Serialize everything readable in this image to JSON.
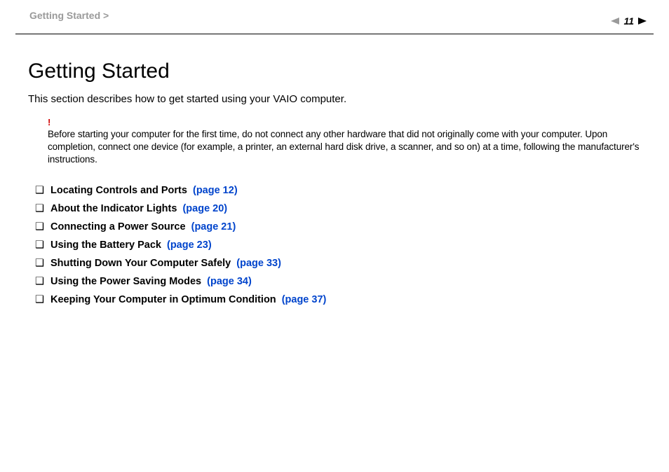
{
  "breadcrumb": "Getting Started >",
  "page_number": "11",
  "title": "Getting Started",
  "intro": "This section describes how to get started using your VAIO computer.",
  "warning_mark": "!",
  "warning_text": "Before starting your computer for the first time, do not connect any other hardware that did not originally come with your computer. Upon completion, connect one device (for example, a printer, an external hard disk drive, a scanner, and so on) at a time, following the manufacturer's instructions.",
  "bullet": "❑",
  "toc": [
    {
      "label": "Locating Controls and Ports",
      "page": "(page 12)"
    },
    {
      "label": "About the Indicator Lights",
      "page": "(page 20)"
    },
    {
      "label": "Connecting a Power Source",
      "page": "(page 21)"
    },
    {
      "label": "Using the Battery Pack",
      "page": "(page 23)"
    },
    {
      "label": "Shutting Down Your Computer Safely",
      "page": "(page 33)"
    },
    {
      "label": "Using the Power Saving Modes",
      "page": "(page 34)"
    },
    {
      "label": "Keeping Your Computer in Optimum Condition",
      "page": "(page 37)"
    }
  ]
}
